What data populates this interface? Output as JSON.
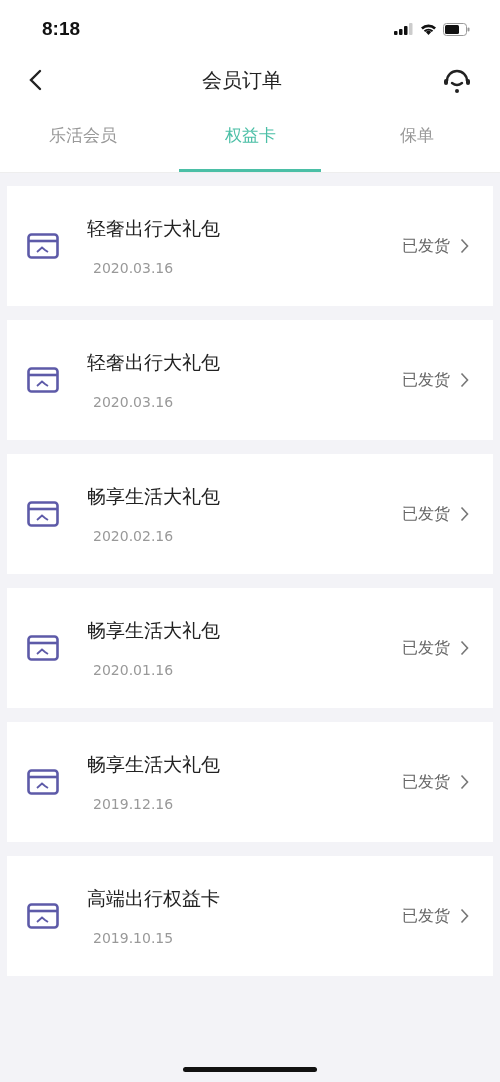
{
  "status_bar": {
    "time": "8:18"
  },
  "nav": {
    "title": "会员订单"
  },
  "tabs": [
    {
      "label": "乐活会员",
      "selected": false
    },
    {
      "label": "权益卡",
      "selected": true
    },
    {
      "label": "保单",
      "selected": false
    }
  ],
  "orders": [
    {
      "name": "轻奢出行大礼包",
      "date": "2020.03.16",
      "status": "已发货"
    },
    {
      "name": "轻奢出行大礼包",
      "date": "2020.03.16",
      "status": "已发货"
    },
    {
      "name": "畅享生活大礼包",
      "date": "2020.02.16",
      "status": "已发货"
    },
    {
      "name": "畅享生活大礼包",
      "date": "2020.01.16",
      "status": "已发货"
    },
    {
      "name": "畅享生活大礼包",
      "date": "2019.12.16",
      "status": "已发货"
    },
    {
      "name": "高端出行权益卡",
      "date": "2019.10.15",
      "status": "已发货"
    }
  ]
}
